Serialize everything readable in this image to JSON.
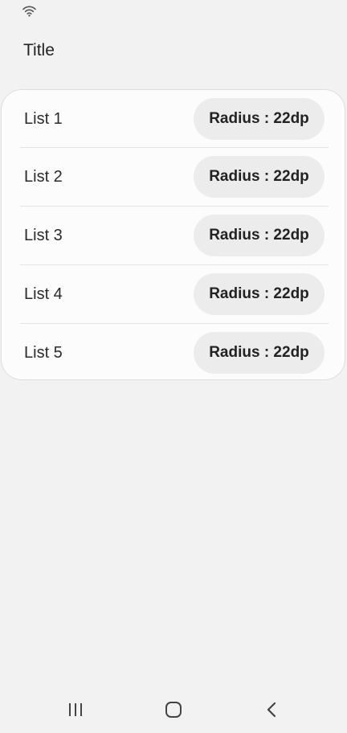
{
  "header": {
    "title": "Title"
  },
  "list": {
    "items": [
      {
        "label": "List 1",
        "chip_label": "Radius : 22dp"
      },
      {
        "label": "List 2",
        "chip_label": "Radius : 22dp"
      },
      {
        "label": "List 3",
        "chip_label": "Radius : 22dp"
      },
      {
        "label": "List 4",
        "chip_label": "Radius : 22dp"
      },
      {
        "label": "List 5",
        "chip_label": "Radius : 22dp"
      }
    ]
  },
  "status_bar": {
    "icons": [
      "wifi-icon"
    ]
  },
  "nav_bar": {
    "icons": [
      "recents-icon",
      "home-icon",
      "back-icon"
    ]
  },
  "colors": {
    "background": "#f2f2f2",
    "card": "#fcfcfc",
    "chip": "#ececec",
    "text": "#222222"
  }
}
